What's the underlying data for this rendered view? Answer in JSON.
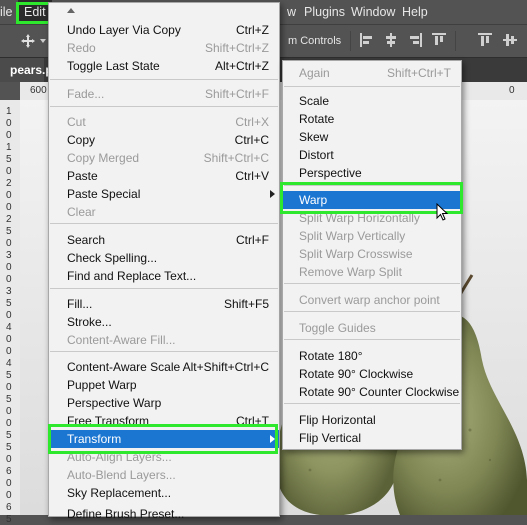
{
  "menubar": {
    "items": [
      "ile",
      "Edit",
      "w",
      "Plugins",
      "Window",
      "Help"
    ]
  },
  "optionsbar": {
    "transform_controls_label": "m Controls"
  },
  "document": {
    "tab_label": "pears.p"
  },
  "rulers": {
    "top_labels": [
      "600",
      "0"
    ],
    "left_labels": [
      "1",
      "0",
      "0",
      "1",
      "5",
      "0",
      "2",
      "0",
      "0",
      "2",
      "5",
      "0",
      "3",
      "0",
      "0",
      "3",
      "5",
      "0",
      "4",
      "0",
      "0",
      "4",
      "5",
      "0",
      "5",
      "0",
      "0",
      "5",
      "5",
      "0",
      "6",
      "0",
      "0",
      "6",
      "5"
    ]
  },
  "edit_menu": {
    "items": [
      {
        "label": "Undo Layer Via Copy",
        "shortcut": "Ctrl+Z",
        "enabled": true
      },
      {
        "label": "Redo",
        "shortcut": "Shift+Ctrl+Z",
        "enabled": false
      },
      {
        "label": "Toggle Last State",
        "shortcut": "Alt+Ctrl+Z",
        "enabled": true
      },
      {
        "label": "Fade...",
        "shortcut": "Shift+Ctrl+F",
        "enabled": false
      },
      {
        "label": "Cut",
        "shortcut": "Ctrl+X",
        "enabled": false
      },
      {
        "label": "Copy",
        "shortcut": "Ctrl+C",
        "enabled": true
      },
      {
        "label": "Copy Merged",
        "shortcut": "Shift+Ctrl+C",
        "enabled": false
      },
      {
        "label": "Paste",
        "shortcut": "Ctrl+V",
        "enabled": true
      },
      {
        "label": "Paste Special",
        "shortcut": "",
        "enabled": true,
        "submenu": true
      },
      {
        "label": "Clear",
        "shortcut": "",
        "enabled": false
      },
      {
        "label": "Search",
        "shortcut": "Ctrl+F",
        "enabled": true
      },
      {
        "label": "Check Spelling...",
        "shortcut": "",
        "enabled": true
      },
      {
        "label": "Find and Replace Text...",
        "shortcut": "",
        "enabled": true
      },
      {
        "label": "Fill...",
        "shortcut": "Shift+F5",
        "enabled": true
      },
      {
        "label": "Stroke...",
        "shortcut": "",
        "enabled": true
      },
      {
        "label": "Content-Aware Fill...",
        "shortcut": "",
        "enabled": false
      },
      {
        "label": "Content-Aware Scale",
        "shortcut": "Alt+Shift+Ctrl+C",
        "enabled": true
      },
      {
        "label": "Puppet Warp",
        "shortcut": "",
        "enabled": true
      },
      {
        "label": "Perspective Warp",
        "shortcut": "",
        "enabled": true
      },
      {
        "label": "Free Transform",
        "shortcut": "Ctrl+T",
        "enabled": true
      },
      {
        "label": "Transform",
        "shortcut": "",
        "enabled": true,
        "submenu": true,
        "selected": true
      },
      {
        "label": "Auto-Align Layers...",
        "shortcut": "",
        "enabled": false
      },
      {
        "label": "Auto-Blend Layers...",
        "shortcut": "",
        "enabled": false
      },
      {
        "label": "Sky Replacement...",
        "shortcut": "",
        "enabled": true
      },
      {
        "label": "Define Brush Preset...",
        "shortcut": "",
        "enabled": true
      }
    ]
  },
  "transform_menu": {
    "items": [
      {
        "label": "Again",
        "shortcut": "Shift+Ctrl+T",
        "enabled": false
      },
      {
        "label": "Scale",
        "shortcut": "",
        "enabled": true
      },
      {
        "label": "Rotate",
        "shortcut": "",
        "enabled": true
      },
      {
        "label": "Skew",
        "shortcut": "",
        "enabled": true
      },
      {
        "label": "Distort",
        "shortcut": "",
        "enabled": true
      },
      {
        "label": "Perspective",
        "shortcut": "",
        "enabled": true
      },
      {
        "label": "Warp",
        "shortcut": "",
        "enabled": true,
        "selected": true
      },
      {
        "label": "Split Warp Horizontally",
        "shortcut": "",
        "enabled": false
      },
      {
        "label": "Split Warp Vertically",
        "shortcut": "",
        "enabled": false
      },
      {
        "label": "Split Warp Crosswise",
        "shortcut": "",
        "enabled": false
      },
      {
        "label": "Remove Warp Split",
        "shortcut": "",
        "enabled": false
      },
      {
        "label": "Convert warp anchor point",
        "shortcut": "",
        "enabled": false
      },
      {
        "label": "Toggle Guides",
        "shortcut": "",
        "enabled": false
      },
      {
        "label": "Rotate 180°",
        "shortcut": "",
        "enabled": true
      },
      {
        "label": "Rotate 90° Clockwise",
        "shortcut": "",
        "enabled": true
      },
      {
        "label": "Rotate 90° Counter Clockwise",
        "shortcut": "",
        "enabled": true
      },
      {
        "label": "Flip Horizontal",
        "shortcut": "",
        "enabled": true
      },
      {
        "label": "Flip Vertical",
        "shortcut": "",
        "enabled": true
      }
    ]
  },
  "colors": {
    "highlight_box": "#2ee82e",
    "selection_blue": "#1b76d2",
    "menu_bg": "#f2f2f2",
    "app_bg": "#535353"
  }
}
